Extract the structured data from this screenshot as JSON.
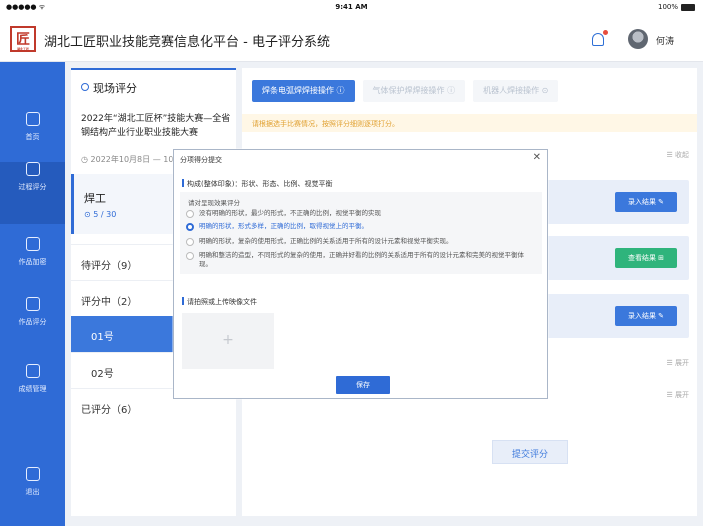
{
  "status": {
    "signal": "●●●●● ᯤ",
    "time": "9:41 AM",
    "battery": "100%"
  },
  "header": {
    "logo_char": "匠",
    "logo_sub": "湖北工匠",
    "title": "湖北工匠职业技能竞赛信息化平台 - 电子评分系统",
    "user": "何涛"
  },
  "sidebar": {
    "items": [
      {
        "label": "首页",
        "icon": "home-icon"
      },
      {
        "label": "过程评分",
        "icon": "edit-icon"
      },
      {
        "label": "作品加密",
        "icon": "lock-icon"
      },
      {
        "label": "作品评分",
        "icon": "scale-icon"
      },
      {
        "label": "成绩管理",
        "icon": "trophy-icon"
      },
      {
        "label": "退出",
        "icon": "logout-icon"
      }
    ]
  },
  "left": {
    "header": "现场评分",
    "competition": "2022年“湖北工匠杯”技能大赛—全省钢结构产业行业职业技能大赛",
    "date": "◷ 2022年10月8日 — 10/",
    "welder": {
      "title": "焊工",
      "progress": "⊙ 5 / 30"
    },
    "pending": "待评分（9）",
    "in_progress": "评分中（2）",
    "items": [
      "01号",
      "02号"
    ],
    "done": "已评分（6）"
  },
  "right": {
    "tabs": [
      "焊条电弧焊焊接操作 ⓘ",
      "气体保护焊焊接操作 ⓘ",
      "机器人焊接操作 ⊙"
    ],
    "tip": "请根据选手比赛情况，按照评分细则逐项打分。",
    "collapse": "☰ 收起",
    "buttons": [
      "录入结果 ✎",
      "查看结果 ⊞",
      "录入结果 ✎"
    ],
    "expand": [
      "☰ 展开",
      "☰ 展开"
    ],
    "submit": "提交评分"
  },
  "modal": {
    "title": "分项得分提交",
    "close": "✕",
    "section": "构成(整体印象)：形状、形态、比例、视觉平衡",
    "hint": "请对呈现效果评分",
    "options": [
      "没有明确的形状，最少的形式，不正确的比例，视觉平衡的实现",
      "明确的形状，形式多样，正确的比例，取得视觉上的平衡。",
      "明确的形状，复杂的使用形式，正确比例的关系适用于所有的设计元素和视觉平衡实现。",
      "明确和整洁的造型，不同形式的复杂的使用，正确并好看的比例的关系适用于所有的设计元素和完美的视觉平衡体现。"
    ],
    "selected": 1,
    "upload_title": "请拍照或上传映像文件",
    "upload_plus": "+",
    "save": "保存"
  },
  "colors": {
    "primary": "#2f6bd6",
    "success": "#2fb47c",
    "warning": "#e0a030",
    "brand_red": "#c0392b"
  }
}
